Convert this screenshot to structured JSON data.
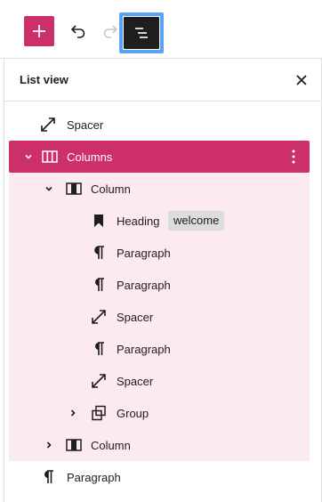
{
  "toolbar": {
    "inserter_icon": "plus-icon",
    "undo_icon": "undo-icon",
    "redo_icon": "redo-icon",
    "listview_icon": "list-view-icon",
    "accent_color": "#cc2f69",
    "focus_color": "#5ba1f5"
  },
  "panel": {
    "title": "List view",
    "close_icon": "close-icon"
  },
  "tree": [
    {
      "label": "Spacer",
      "icon": "spacer-icon"
    },
    {
      "label": "Columns",
      "icon": "columns-icon",
      "expanded": true,
      "selected": true
    },
    {
      "label": "Column",
      "icon": "column-icon",
      "expanded": true
    },
    {
      "label": "Heading",
      "icon": "heading-icon",
      "badge": "welcome"
    },
    {
      "label": "Paragraph",
      "icon": "paragraph-icon"
    },
    {
      "label": "Paragraph",
      "icon": "paragraph-icon"
    },
    {
      "label": "Spacer",
      "icon": "spacer-icon"
    },
    {
      "label": "Paragraph",
      "icon": "paragraph-icon"
    },
    {
      "label": "Spacer",
      "icon": "spacer-icon"
    },
    {
      "label": "Group",
      "icon": "group-icon",
      "expanded": false
    },
    {
      "label": "Column",
      "icon": "column-icon",
      "expanded": false
    },
    {
      "label": "Paragraph",
      "icon": "paragraph-icon"
    }
  ]
}
